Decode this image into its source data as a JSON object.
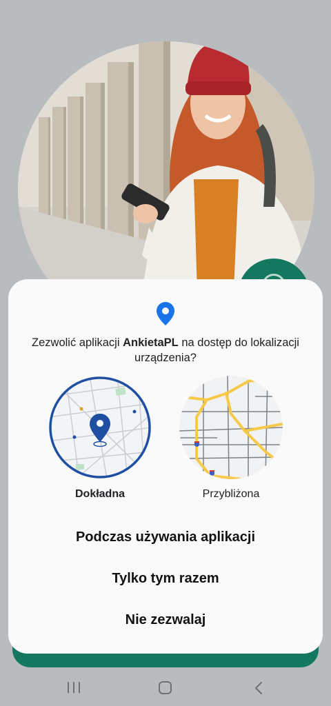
{
  "dialog": {
    "question_prefix": "Zezwolić aplikacji ",
    "app_name": "AnkietaPL",
    "question_suffix": " na dostęp do lokalizacji urządzenia?",
    "options": {
      "precise_label": "Dokładna",
      "approximate_label": "Przybliżona",
      "selected": "Dokładna"
    },
    "actions": {
      "while_using": "Podczas używania aplikacji",
      "only_this_time": "Tylko tym razem",
      "deny": "Nie zezwalaj"
    }
  },
  "icons": {
    "location_pin": "location-pin-icon",
    "nav_recents": "recent-apps-icon",
    "nav_home": "home-icon",
    "nav_back": "back-icon"
  },
  "colors": {
    "accent_blue": "#1a73e8",
    "precise_ring": "#1f4fa3",
    "brand_green": "#13785f",
    "road_yellow": "#f7c948"
  }
}
